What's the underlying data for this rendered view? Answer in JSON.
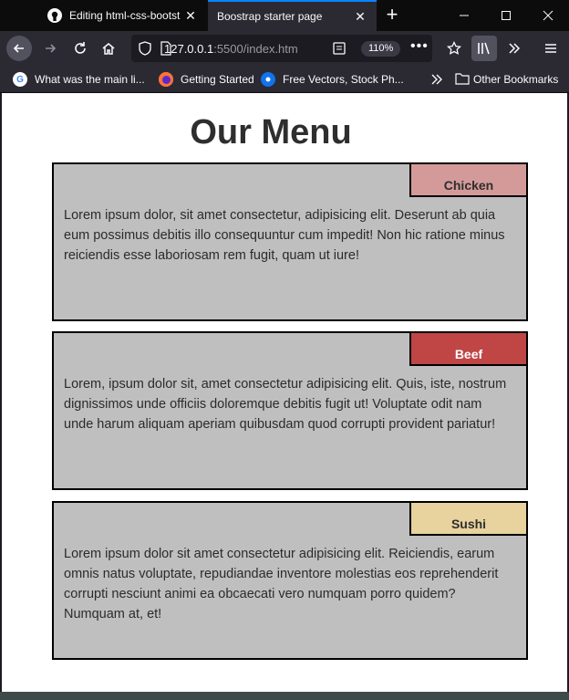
{
  "browser": {
    "tabs": [
      {
        "title": "Editing html-css-bootst",
        "active": false,
        "icon": "github-icon"
      },
      {
        "title": "Boostrap starter page",
        "active": true,
        "icon": "none"
      }
    ],
    "new_tab_glyph": "+",
    "url_host": "127.0.0.1",
    "url_rest": ":5500/index.htm",
    "zoom": "110%",
    "bookmarks": [
      {
        "label": "What was the main li...",
        "icon": "google-icon"
      },
      {
        "label": "Getting Started",
        "icon": "firefox-icon"
      },
      {
        "label": "Free Vectors, Stock Ph...",
        "icon": "freepik-icon"
      }
    ],
    "other_bookmarks": "Other Bookmarks"
  },
  "page": {
    "title": "Our Menu",
    "items": [
      {
        "name": "Chicken",
        "color": "#d49a9a",
        "text_color": "#2e2e2e",
        "description": "Lorem ipsum dolor, sit amet consectetur, adipisicing elit. Deserunt ab quia eum possimus debitis illo consequuntur cum impedit! Non hic ratione minus reiciendis esse laboriosam rem fugit, quam ut iure!"
      },
      {
        "name": "Beef",
        "color": "#c04545",
        "text_color": "#ffffff",
        "description": "Lorem, ipsum dolor sit, amet consectetur adipisicing elit. Quis, iste, nostrum dignissimos unde officiis doloremque debitis fugit ut! Voluptate odit nam unde harum aliquam aperiam quibusdam quod corrupti provident pariatur!"
      },
      {
        "name": "Sushi",
        "color": "#e8d29d",
        "text_color": "#2e2e2e",
        "description": "Lorem ipsum dolor sit amet consectetur adipisicing elit. Reiciendis, earum omnis natus voluptate, repudiandae inventore molestias eos reprehenderit corrupti nesciunt animi ea obcaecati vero numquam porro quidem? Numquam at, et!"
      }
    ]
  }
}
